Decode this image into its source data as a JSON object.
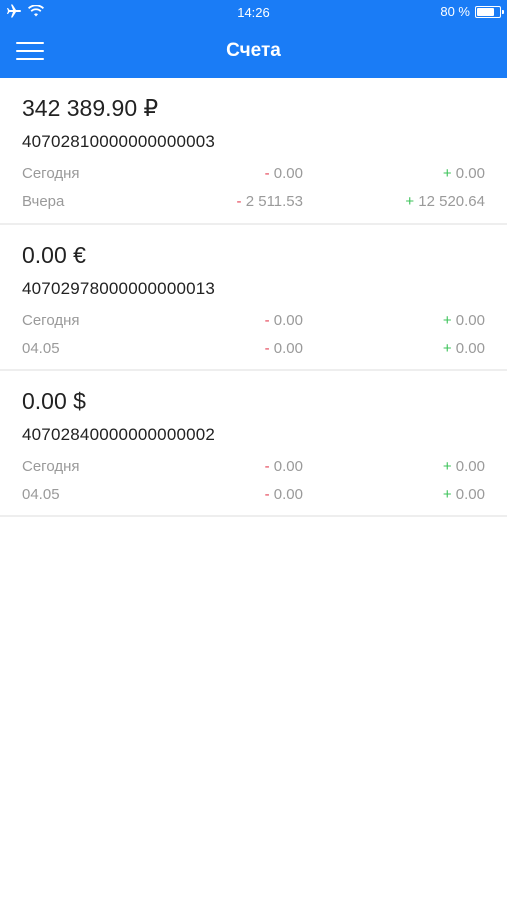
{
  "status_bar": {
    "time": "14:26",
    "battery_percent": "80 %",
    "battery_level": 0.8,
    "icons": [
      "airplane-icon",
      "wifi-icon",
      "battery-icon"
    ]
  },
  "nav": {
    "title": "Счета",
    "menu_icon": "hamburger-menu-icon"
  },
  "colors": {
    "header_bg": "#1a7cf6",
    "minus": "#e5475a",
    "plus": "#3cc35a",
    "muted": "#9a9a9a"
  },
  "accounts": [
    {
      "balance": "342 389.90 ₽",
      "number": "40702810000000000003",
      "rows": [
        {
          "label": "Сегодня",
          "minus_sign": "-",
          "minus_value": "0.00",
          "plus_sign": "+",
          "plus_value": "0.00"
        },
        {
          "label": "Вчера",
          "minus_sign": "-",
          "minus_value": "2 511.53",
          "plus_sign": "+",
          "plus_value": "12 520.64"
        }
      ]
    },
    {
      "balance": "0.00 €",
      "number": "40702978000000000013",
      "rows": [
        {
          "label": "Сегодня",
          "minus_sign": "-",
          "minus_value": "0.00",
          "plus_sign": "+",
          "plus_value": "0.00"
        },
        {
          "label": "04.05",
          "minus_sign": "-",
          "minus_value": "0.00",
          "plus_sign": "+",
          "plus_value": "0.00"
        }
      ]
    },
    {
      "balance": "0.00 $",
      "number": "40702840000000000002",
      "rows": [
        {
          "label": "Сегодня",
          "minus_sign": "-",
          "minus_value": "0.00",
          "plus_sign": "+",
          "plus_value": "0.00"
        },
        {
          "label": "04.05",
          "minus_sign": "-",
          "minus_value": "0.00",
          "plus_sign": "+",
          "plus_value": "0.00"
        }
      ]
    }
  ]
}
